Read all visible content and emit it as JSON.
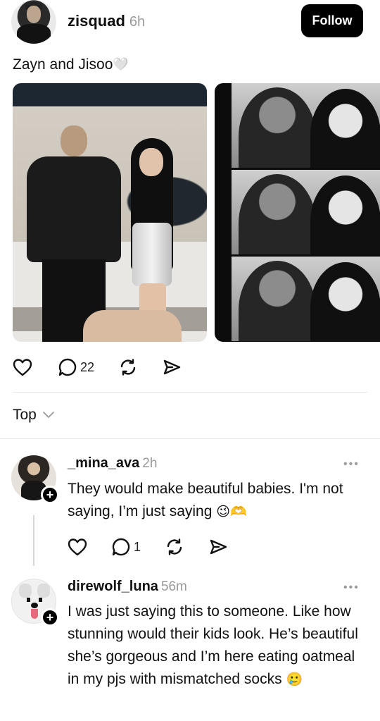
{
  "post": {
    "username": "zisquad",
    "time": "6h",
    "follow_label": "Follow",
    "caption": "Zayn and Jisoo",
    "caption_emoji": "🤍",
    "actions": {
      "reply_count": "22"
    }
  },
  "filter": {
    "label": "Top"
  },
  "comments": [
    {
      "username": "_mina_ava",
      "time": "2h",
      "text": "They would make beautiful babies. I'm not saying, I’m just saying",
      "emoji": "😉🫶",
      "reply_count": "1",
      "more": "•••"
    },
    {
      "username": "direwolf_luna",
      "time": "56m",
      "text": "I was just saying this to someone. Like how stunning would their kids look. He’s beautiful she’s gorgeous and I’m here eating oatmeal in my pjs with mismatched socks",
      "emoji": "🥲",
      "more": "•••"
    }
  ],
  "icons": {
    "like": "heart-icon",
    "reply": "comment-icon",
    "repost": "repost-icon",
    "share": "send-icon",
    "chevron": "chevron-down-icon",
    "plus": "+"
  },
  "colors": {
    "accent": "#000000",
    "muted": "#9a9a9a",
    "divider": "#e8e8e8"
  }
}
